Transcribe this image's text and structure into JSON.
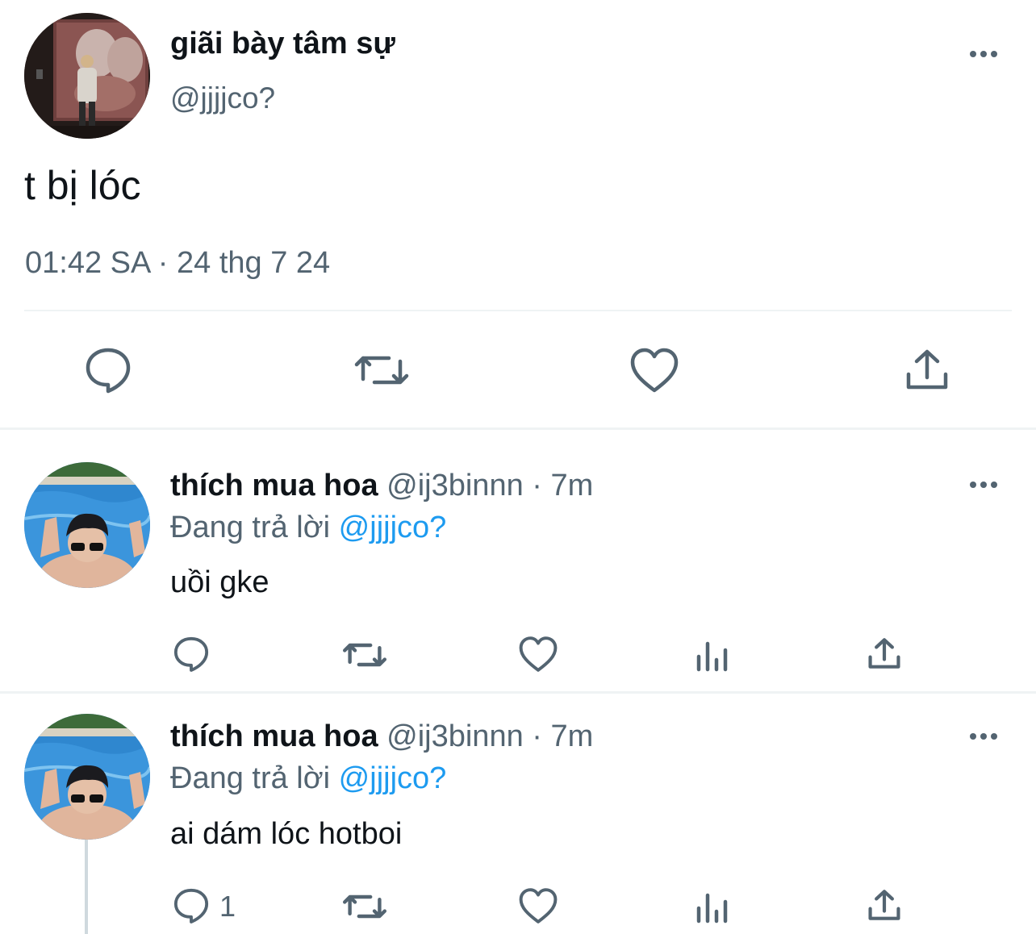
{
  "main_tweet": {
    "display_name": "giãi bày tâm sự",
    "handle": "@jjjjco?",
    "text": "t bị lóc",
    "timestamp": "01:42 SA · 24 thg 7 24",
    "actions": [
      {
        "name": "reply-icon"
      },
      {
        "name": "retweet-icon"
      },
      {
        "name": "like-icon"
      },
      {
        "name": "share-icon"
      }
    ]
  },
  "replies": [
    {
      "display_name": "thích mua hoa",
      "handle": "@ij3binnn",
      "separator": "·",
      "time": "7m",
      "replying_prefix": "Đang trả lời",
      "replying_to": "@jjjjco?",
      "text": "uồi gke",
      "reply_count": ""
    },
    {
      "display_name": "thích mua hoa",
      "handle": "@ij3binnn",
      "separator": "·",
      "time": "7m",
      "replying_prefix": "Đang trả lời",
      "replying_to": "@jjjjco?",
      "text": "ai dám lóc hotboi",
      "reply_count": "1"
    }
  ],
  "colors": {
    "text": "#0f1419",
    "muted": "#536471",
    "link": "#1d9bf0",
    "divider": "#eff3f4"
  }
}
